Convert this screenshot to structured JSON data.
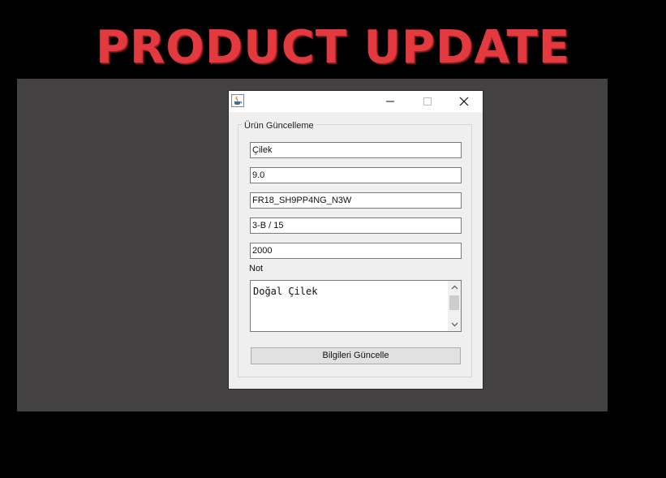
{
  "banner": {
    "title": "PRODUCT UPDATE"
  },
  "window": {
    "title": "",
    "group_title": "Ürün Güncelleme",
    "fields": [
      {
        "value": "Çilek"
      },
      {
        "value": "9.0"
      },
      {
        "value": "FR18_SH9PP4NG_N3W"
      },
      {
        "value": "3-B / 15"
      },
      {
        "value": "2000"
      }
    ],
    "note_label": "Not",
    "note_value": "Doğal Çilek",
    "update_button": "Bilgileri Güncelle"
  },
  "icons": {
    "app": "java-cup-icon",
    "minimize": "minimize-icon",
    "maximize": "maximize-icon",
    "close": "close-icon",
    "scroll_up": "chevron-up-icon",
    "scroll_down": "chevron-down-icon"
  },
  "colors": {
    "banner_title": "#e23a3f",
    "desktop": "#434141",
    "window_bg": "#efefef"
  }
}
